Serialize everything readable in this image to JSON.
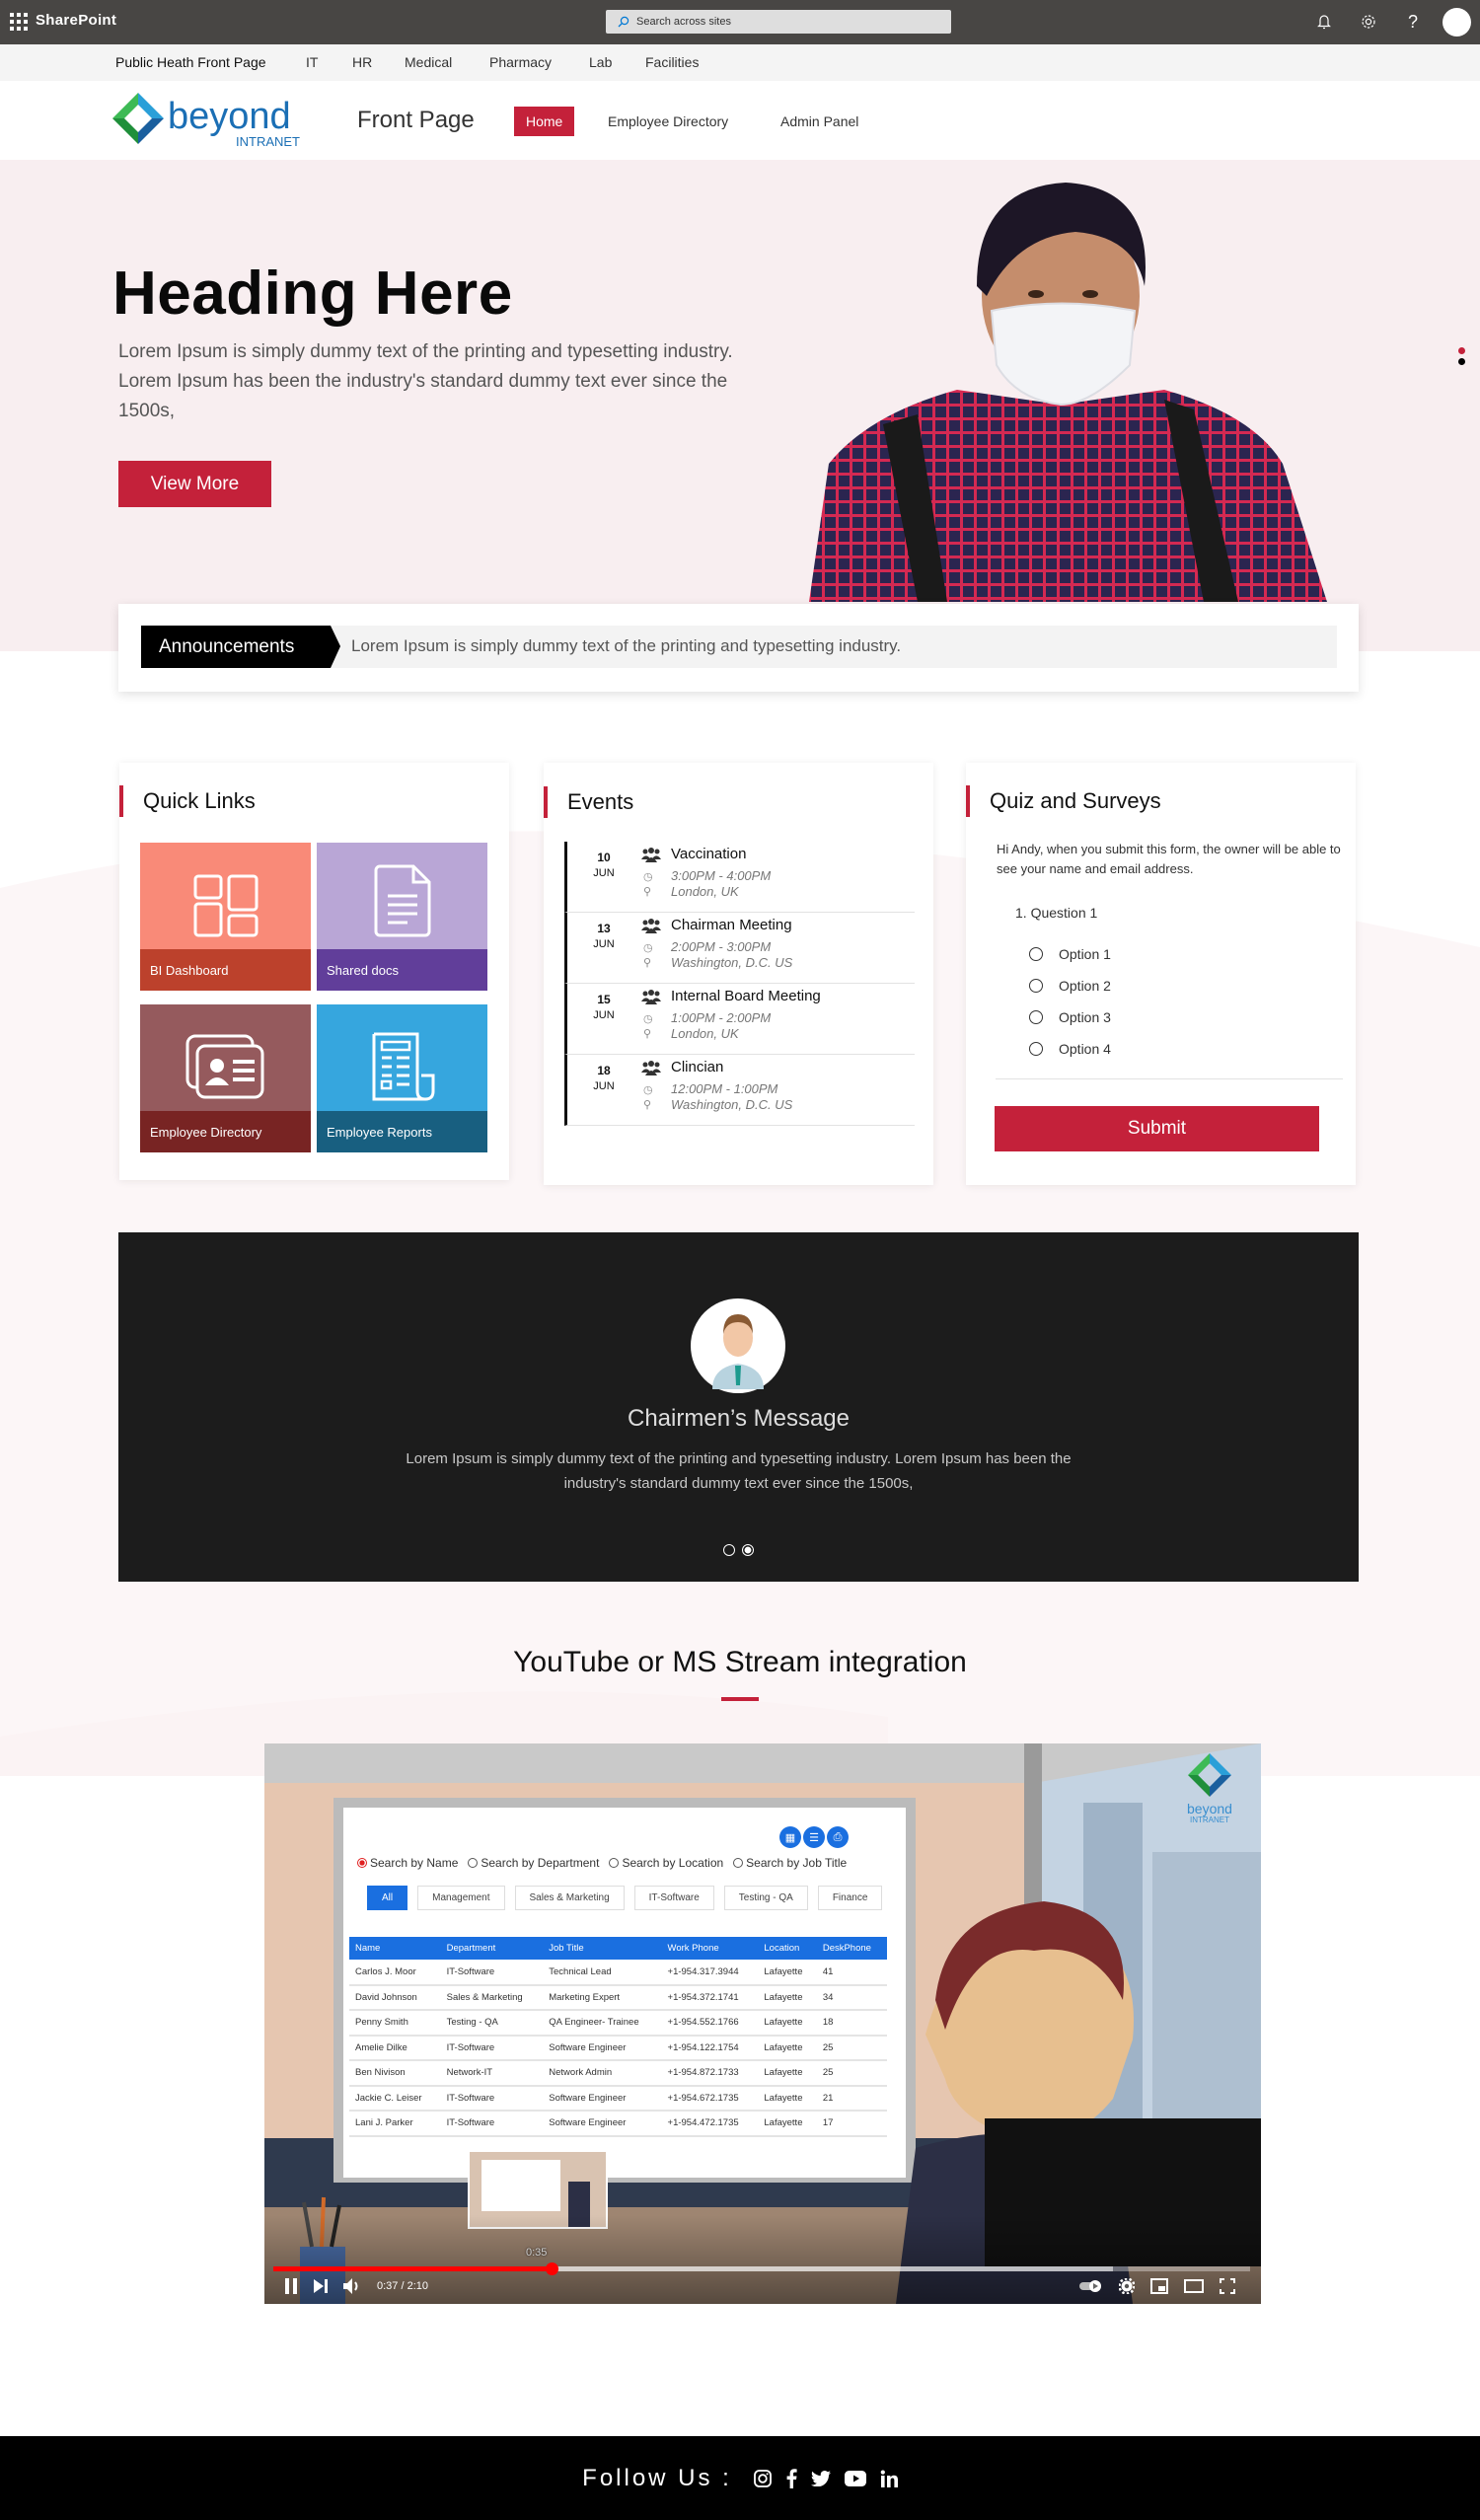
{
  "suite_bar": {
    "app_name": "SharePoint",
    "search_placeholder": "Search across sites",
    "icons": [
      "app-launcher-icon",
      "bell-icon",
      "gear-icon",
      "help-icon",
      "avatar"
    ]
  },
  "hub_nav": {
    "site_title": "Public Heath Front Page",
    "links": [
      "IT",
      "HR",
      "Medical",
      "Pharmacy",
      "Lab",
      "Facilities"
    ]
  },
  "site_header": {
    "logo_text": "beyond",
    "logo_subtext": "INTRANET",
    "page_title": "Front Page",
    "nav": [
      {
        "label": "Home",
        "active": true
      },
      {
        "label": "Employee Directory",
        "active": false
      },
      {
        "label": "Admin Panel",
        "active": false
      }
    ]
  },
  "hero": {
    "heading": "Heading Here",
    "text": "Lorem Ipsum is simply dummy text of the printing and typesetting industry. Lorem Ipsum has been the industry's standard dummy text ever since the 1500s,",
    "button": "View More",
    "slide_count": 2,
    "active_slide": 1
  },
  "announcements": {
    "label": "Announcements",
    "text": "Lorem Ipsum is simply dummy text of the printing and typesetting industry."
  },
  "quick_links": {
    "title": "Quick Links",
    "tiles": [
      {
        "label": "BI Dashboard",
        "icon": "dashboard-icon",
        "color": "#f98a78",
        "foot_color": "#bc412c"
      },
      {
        "label": "Shared docs",
        "icon": "document-icon",
        "color": "#b9a6d6",
        "foot_color": "#613e9a"
      },
      {
        "label": "Employee Directory",
        "icon": "contact-card-icon",
        "color": "#955a5d",
        "foot_color": "#782423"
      },
      {
        "label": "Employee Reports",
        "icon": "report-icon",
        "color": "#36a6de",
        "foot_color": "#185f80"
      }
    ]
  },
  "events": {
    "title": "Events",
    "items": [
      {
        "day": "10",
        "month": "JUN",
        "name": "Vaccination",
        "time": "3:00PM - 4:00PM",
        "location": "London, UK"
      },
      {
        "day": "13",
        "month": "JUN",
        "name": "Chairman Meeting",
        "time": "2:00PM - 3:00PM",
        "location": "Washington, D.C. US"
      },
      {
        "day": "15",
        "month": "JUN",
        "name": "Internal Board Meeting",
        "time": "1:00PM - 2:00PM",
        "location": "London, UK"
      },
      {
        "day": "18",
        "month": "JUN",
        "name": "Clincian",
        "time": "12:00PM - 1:00PM",
        "location": "Washington, D.C. US"
      }
    ]
  },
  "quiz": {
    "title": "Quiz and Surveys",
    "intro": "Hi Andy, when you submit this form, the owner will be able to see your name and email address.",
    "question": "1. Question 1",
    "options": [
      "Option 1",
      "Option 2",
      "Option 3",
      "Option 4"
    ],
    "submit": "Submit"
  },
  "chairman": {
    "title": "Chairmen’s Message",
    "text": "Lorem Ipsum is simply dummy text of the printing and typesetting industry. Lorem Ipsum has been the industry's standard dummy text ever since the 1500s,",
    "slide_count": 2,
    "active_slide": 2
  },
  "video_section": {
    "title": "YouTube or MS Stream integration",
    "player": {
      "current_time": "0:37",
      "duration": "2:10",
      "time_display": "0:37 / 2:10",
      "hover_time": "0:35",
      "progress": 0.285,
      "buffered": 0.86
    },
    "frame": {
      "logo_text": "beyond",
      "logo_subtext": "INTRANET",
      "search_modes": [
        {
          "label": "Search by Name",
          "selected": true
        },
        {
          "label": "Search by Department",
          "selected": false
        },
        {
          "label": "Search by Location",
          "selected": false
        },
        {
          "label": "Search by Job Title",
          "selected": false
        }
      ],
      "filters": [
        {
          "label": "All",
          "active": true
        },
        {
          "label": "Management",
          "active": false
        },
        {
          "label": "Sales & Marketing",
          "active": false
        },
        {
          "label": "IT-Software",
          "active": false
        },
        {
          "label": "Testing - QA",
          "active": false
        },
        {
          "label": "Finance",
          "active": false
        }
      ],
      "table": {
        "columns": [
          "Name",
          "Department",
          "Job Title",
          "Work Phone",
          "Location",
          "DeskPhone"
        ],
        "rows": [
          [
            "Carlos J. Moor",
            "IT-Software",
            "Technical Lead",
            "+1-954.317.3944",
            "Lafayette",
            "41"
          ],
          [
            "David Johnson",
            "Sales & Marketing",
            "Marketing Expert",
            "+1-954.372.1741",
            "Lafayette",
            "34"
          ],
          [
            "Penny Smith",
            "Testing - QA",
            "QA Engineer- Trainee",
            "+1-954.552.1766",
            "Lafayette",
            "18"
          ],
          [
            "Amelie Dilke",
            "IT-Software",
            "Software Engineer",
            "+1-954.122.1754",
            "Lafayette",
            "25"
          ],
          [
            "Ben Nivison",
            "Network-IT",
            "Network Admin",
            "+1-954.872.1733",
            "Lafayette",
            "25"
          ],
          [
            "Jackie C. Leiser",
            "IT-Software",
            "Software Engineer",
            "+1-954.672.1735",
            "Lafayette",
            "21"
          ],
          [
            "Lani J. Parker",
            "IT-Software",
            "Software Engineer",
            "+1-954.472.1735",
            "Lafayette",
            "17"
          ]
        ]
      }
    }
  },
  "footer": {
    "label": "Follow Us :",
    "social": [
      "instagram-icon",
      "facebook-icon",
      "twitter-icon",
      "youtube-icon",
      "linkedin-icon"
    ]
  },
  "colors": {
    "accent": "#c4213a",
    "suite_bar": "#484644",
    "hero_bg": "#f8eef0",
    "table_header": "#1a6fe0"
  }
}
